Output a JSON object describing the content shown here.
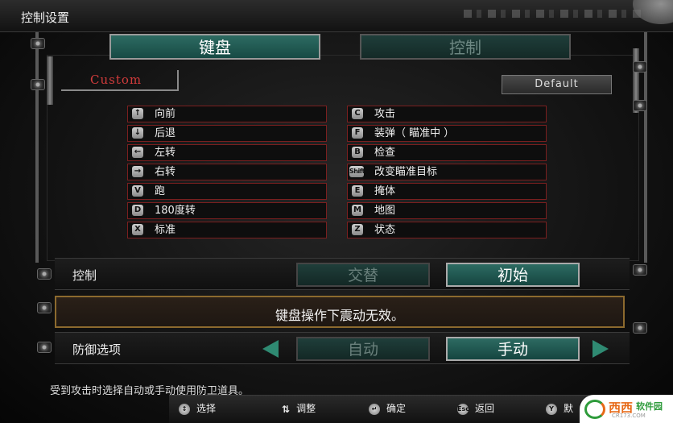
{
  "window": {
    "title": "控制设置"
  },
  "tabs": [
    {
      "label": "键盘",
      "active": true
    },
    {
      "label": "控制",
      "active": false
    }
  ],
  "preset": {
    "name": "Custom",
    "default_label": "Default"
  },
  "bindings_left": [
    {
      "key": "↑",
      "action": "向前"
    },
    {
      "key": "↓",
      "action": "后退"
    },
    {
      "key": "←",
      "action": "左转"
    },
    {
      "key": "→",
      "action": "右转"
    },
    {
      "key": "V",
      "action": "跑"
    },
    {
      "key": "D",
      "action": "180度转"
    },
    {
      "key": "X",
      "action": "标准"
    }
  ],
  "bindings_right": [
    {
      "key": "C",
      "action": "攻击"
    },
    {
      "key": "F",
      "action": "装弹（ 瞄准中 ）"
    },
    {
      "key": "B",
      "action": "检查"
    },
    {
      "key": "Shift",
      "action": "改变瞄准目标"
    },
    {
      "key": "E",
      "action": "掩体"
    },
    {
      "key": "M",
      "action": "地图"
    },
    {
      "key": "Z",
      "action": "状态"
    }
  ],
  "control_row": {
    "label": "控制",
    "option_a": "交替",
    "option_b": "初始",
    "selected": "初始"
  },
  "message": "键盘操作下震动无效。",
  "defense_row": {
    "label": "防御选项",
    "option_a": "自动",
    "option_b": "手动",
    "selected": "手动"
  },
  "help_text": "受到攻击时选择自动或手动使用防卫道具。",
  "hints": [
    {
      "key": "↕",
      "label": "选择"
    },
    {
      "key": "⇅",
      "label": "调整"
    },
    {
      "key": "↵",
      "label": "确定"
    },
    {
      "key": "Esc",
      "label": "返回"
    },
    {
      "key": "Y",
      "label": "默"
    }
  ],
  "watermark": {
    "brand": "西西",
    "tag": "软件园",
    "url": "CR173.COM"
  },
  "colors": {
    "teal_active": "#2d6b62",
    "red_border": "#7a1f1f",
    "custom_red": "#d13b3b",
    "arrow_green": "#2f8a72",
    "message_border": "#8c6a2e"
  }
}
